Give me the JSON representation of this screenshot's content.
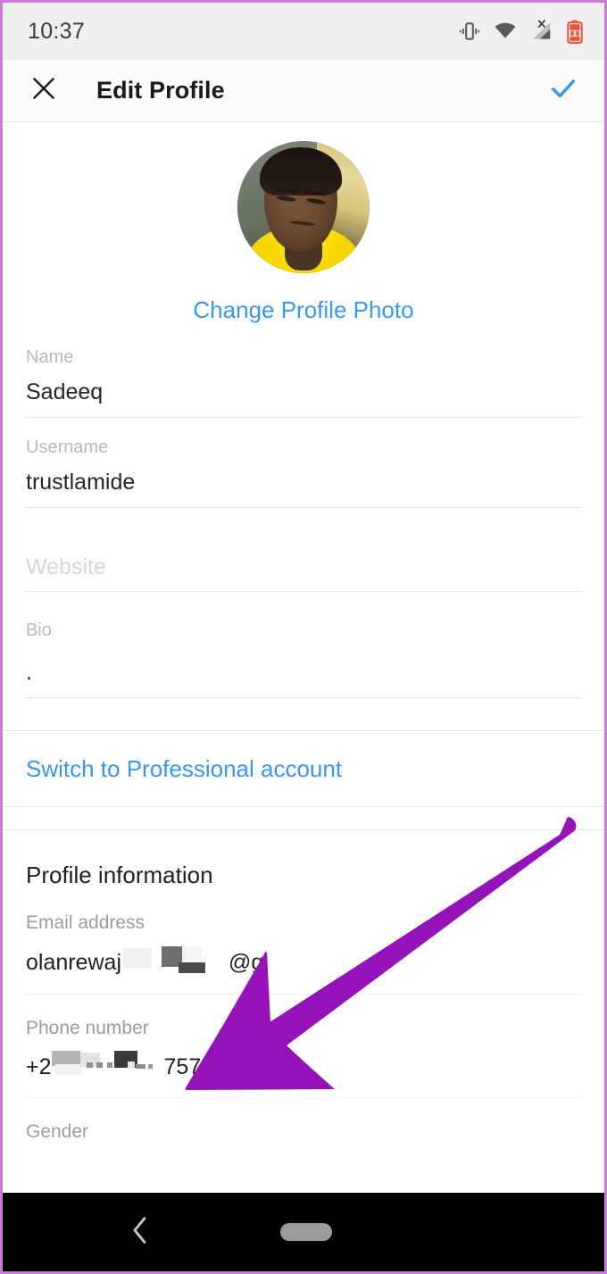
{
  "status_bar": {
    "time": "10:37",
    "icons": [
      "vibrate-icon",
      "wifi-icon",
      "cell-signal-no-sim-icon",
      "battery-low-icon"
    ]
  },
  "app_bar": {
    "close_icon": "close-icon",
    "title": "Edit Profile",
    "confirm_icon": "check-icon",
    "accent_color": "#3897f0"
  },
  "profile": {
    "avatar_alt": "profile-photo",
    "change_photo_label": "Change Profile Photo",
    "fields": [
      {
        "label": "Name",
        "value": "Sadeeq",
        "placeholder": ""
      },
      {
        "label": "Username",
        "value": "trustlamide",
        "placeholder": ""
      },
      {
        "label": "",
        "value": "",
        "placeholder": "Website"
      },
      {
        "label": "Bio",
        "value": ".",
        "placeholder": ""
      }
    ]
  },
  "switch_account": {
    "label": "Switch to Professional account",
    "color": "#3897f0"
  },
  "profile_information": {
    "title": "Profile information",
    "email": {
      "label": "Email address",
      "value_visible_start": "olanrewaj",
      "value_visible_end": "@g",
      "redacted": true
    },
    "phone": {
      "label": "Phone number",
      "value_visible_start": "+2",
      "value_visible_end": "757",
      "redacted": true
    },
    "gender": {
      "label": "Gender",
      "value": ""
    }
  },
  "annotation": {
    "type": "arrow",
    "color": "#9313b8",
    "points_to": "phone-number-field",
    "direction": "down-left"
  },
  "nav_bar": {
    "back_icon": "back-chevron-icon",
    "home_icon": "home-pill-icon",
    "background": "#000000"
  }
}
